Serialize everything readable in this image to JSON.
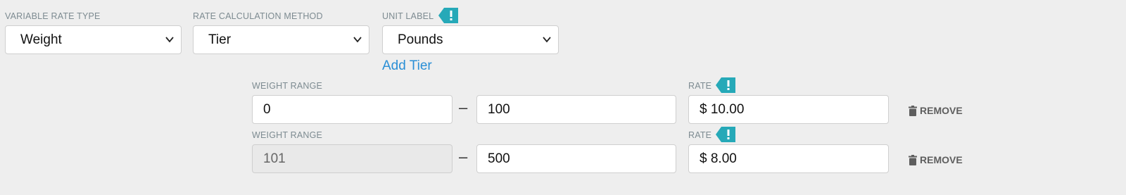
{
  "top_row": {
    "variable_rate_type": {
      "label": "Variable Rate Type",
      "value": "Weight"
    },
    "rate_calculation_method": {
      "label": "Rate Calculation Method",
      "value": "Tier"
    },
    "unit_label": {
      "label": "Unit Label",
      "value": "Pounds",
      "info_icon": "exclamation-tag-icon"
    }
  },
  "add_tier_label": "Add Tier",
  "tiers": [
    {
      "range_label": "Weight Range",
      "from": "0",
      "to": "100",
      "rate_label": "Rate",
      "rate": "$ 10.00",
      "remove_label": "REMOVE",
      "from_disabled": false
    },
    {
      "range_label": "Weight Range",
      "from": "101",
      "to": "500",
      "rate_label": "Rate",
      "rate": "$ 8.00",
      "remove_label": "REMOVE",
      "from_disabled": true
    }
  ],
  "range_separator": "–",
  "colors": {
    "accent_tag": "#26a9b8",
    "link": "#2a8fd6",
    "background": "#eeeeee"
  }
}
